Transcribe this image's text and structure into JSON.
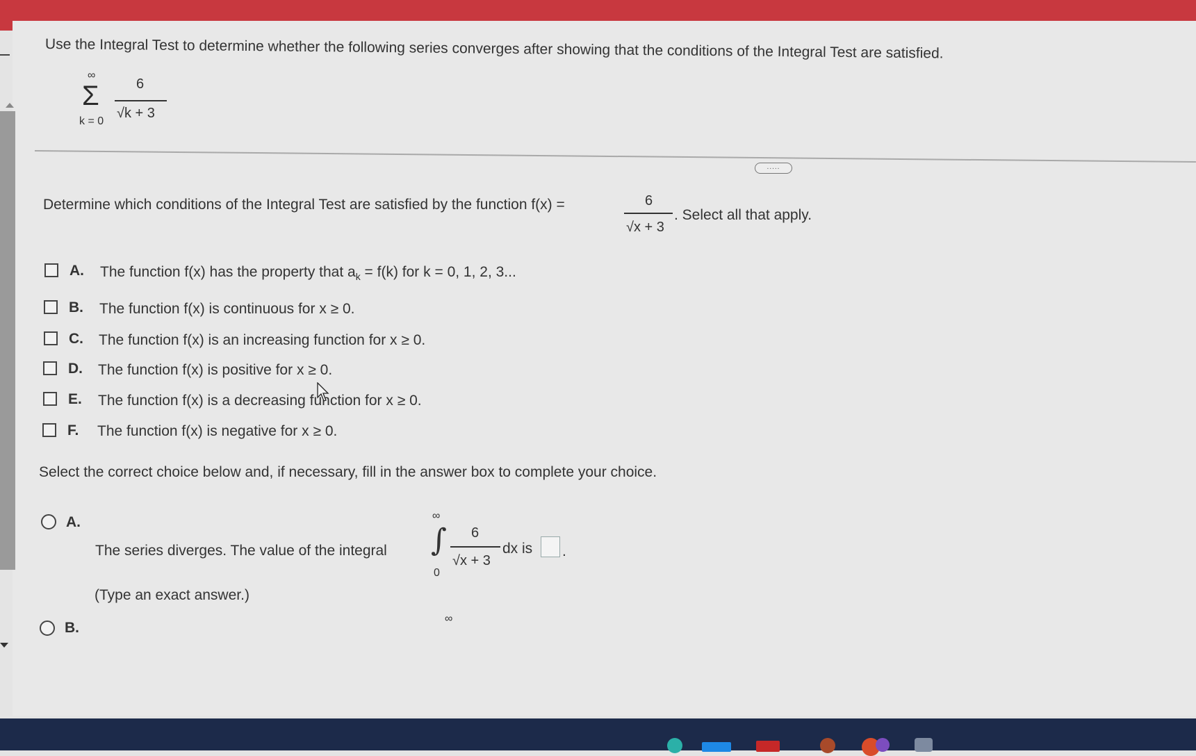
{
  "question": {
    "prompt": "Use the Integral Test to determine whether the following series converges after showing that the conditions of the Integral Test are satisfied.",
    "series": {
      "upper": "∞",
      "lower": "k = 0",
      "numerator": "6",
      "denominator": "√k + 3"
    }
  },
  "more_button": {
    "label": "....."
  },
  "part1": {
    "prompt_before": "Determine which conditions of the Integral Test are satisfied by the function f(x) =",
    "fraction_numerator": "6",
    "fraction_denominator": "√x + 3",
    "prompt_after": ". Select all that apply.",
    "options": [
      {
        "letter": "A.",
        "text": "The function f(x) has the property that a",
        "subscript": "k",
        "text_after": " = f(k) for k = 0, 1, 2, 3..."
      },
      {
        "letter": "B.",
        "text": "The function f(x) is continuous for x ≥ 0."
      },
      {
        "letter": "C.",
        "text": "The function f(x) is an increasing function for x ≥ 0."
      },
      {
        "letter": "D.",
        "text": "The function f(x) is positive for x ≥ 0."
      },
      {
        "letter": "E.",
        "text": "The function f(x) is a decreasing function for x ≥ 0."
      },
      {
        "letter": "F.",
        "text": "The function f(x) is negative for x ≥ 0."
      }
    ]
  },
  "part2": {
    "prompt": "Select the correct choice below and, if necessary, fill in the answer box to complete your choice.",
    "choiceA": {
      "letter": "A.",
      "text": "The series diverges. The value of the integral",
      "upper": "∞",
      "lower": "0",
      "numerator": "6",
      "denominator": "√x + 3",
      "after": "dx is",
      "period": ".",
      "hint": "(Type an exact answer.)"
    },
    "choiceB": {
      "letter": "B.",
      "upper": "∞"
    }
  }
}
